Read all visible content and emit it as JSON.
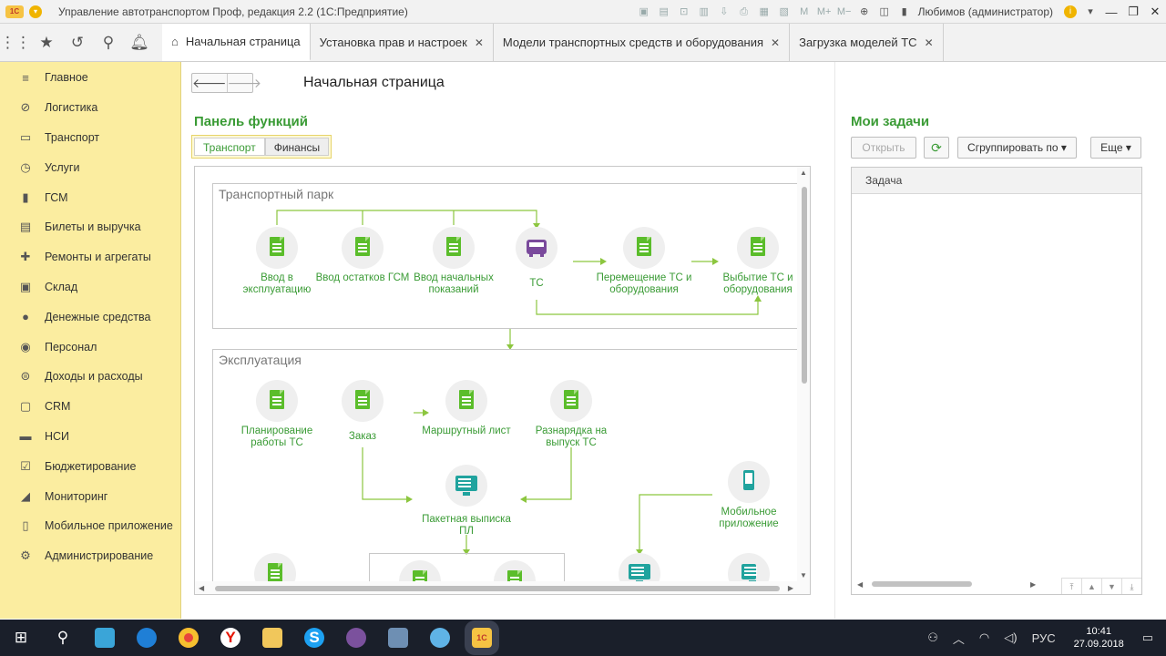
{
  "titlebar": {
    "app_title": "Управление автотранспортом Проф, редакция 2.2  (1С:Предприятие)",
    "user": "Любимов (администратор)",
    "logo_text": "1С"
  },
  "tabs": [
    {
      "label": "Начальная страница",
      "active": true
    },
    {
      "label": "Установка прав и настроек",
      "active": false
    },
    {
      "label": "Модели транспортных средств и оборудования",
      "active": false
    },
    {
      "label": "Загрузка моделей ТС",
      "active": false
    }
  ],
  "sidebar": {
    "items": [
      {
        "label": "Главное",
        "icon": "menu-lines-icon"
      },
      {
        "label": "Логистика",
        "icon": "compass-icon"
      },
      {
        "label": "Транспорт",
        "icon": "truck-icon"
      },
      {
        "label": "Услуги",
        "icon": "clock-icon"
      },
      {
        "label": "ГСМ",
        "icon": "fuel-icon"
      },
      {
        "label": "Билеты и выручка",
        "icon": "ticket-icon"
      },
      {
        "label": "Ремонты и агрегаты",
        "icon": "wrench-icon"
      },
      {
        "label": "Склад",
        "icon": "warehouse-icon"
      },
      {
        "label": "Денежные средства",
        "icon": "money-icon"
      },
      {
        "label": "Персонал",
        "icon": "person-icon"
      },
      {
        "label": "Доходы и расходы",
        "icon": "coins-icon"
      },
      {
        "label": "CRM",
        "icon": "crm-icon"
      },
      {
        "label": "НСИ",
        "icon": "reference-icon"
      },
      {
        "label": "Бюджетирование",
        "icon": "budget-icon"
      },
      {
        "label": "Мониторинг",
        "icon": "monitor-icon"
      },
      {
        "label": "Мобильное приложение",
        "icon": "mobile-icon"
      },
      {
        "label": "Администрирование",
        "icon": "gear-icon"
      }
    ]
  },
  "main": {
    "page_title": "Начальная страница",
    "functions_title": "Панель функций",
    "function_tabs": [
      "Транспорт",
      "Финансы"
    ],
    "groups": {
      "fleet": {
        "title": "Транспортный парк",
        "nodes": [
          "Ввод в эксплуатацию",
          "Ввод остатков ГСМ",
          "Ввод начальных показаний",
          "ТС",
          "Перемещение ТС и оборудования",
          "Выбытие ТС и оборудования"
        ]
      },
      "operation": {
        "title": "Эксплуатация",
        "nodes": [
          "Планирование работы ТС",
          "Заказ",
          "Маршрутный лист",
          "Разнарядка на выпуск ТС",
          "Пакетная выписка ПЛ",
          "Мобильное приложение"
        ]
      }
    }
  },
  "tasks": {
    "title": "Мои задачи",
    "open_button": "Открыть",
    "group_button": "Сгруппировать по",
    "more_button": "Еще",
    "column": "Задача"
  },
  "taskbar": {
    "lang": "РУС",
    "time": "10:41",
    "date": "27.09.2018"
  },
  "colors": {
    "accent_green": "#3a9b35",
    "sidebar_bg": "#fbeda0",
    "doc_green": "#5bbd2b",
    "truck_purple": "#7a4a9c",
    "teal": "#20a39e"
  }
}
